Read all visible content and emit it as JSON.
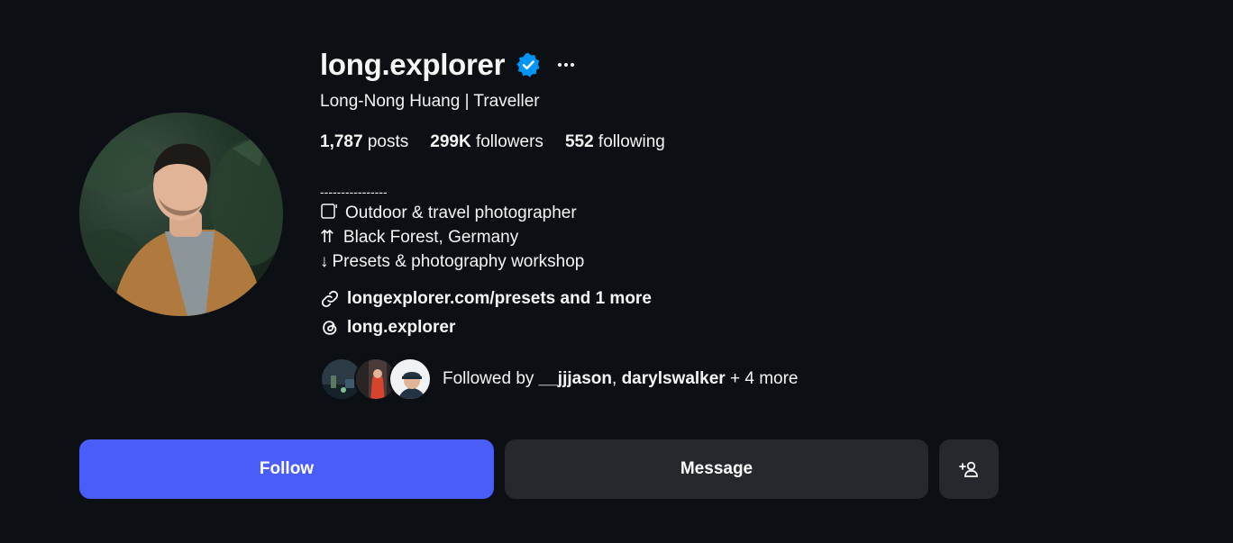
{
  "profile": {
    "username": "long.explorer",
    "full_name": "Long-Nong Huang | Traveller",
    "verified": true
  },
  "stats": {
    "posts_count": "1,787",
    "posts_label": "posts",
    "followers_count": "299K",
    "followers_label": "followers",
    "following_count": "552",
    "following_label": "following"
  },
  "bio": {
    "divider": "----------------",
    "line1": "Outdoor & travel photographer",
    "line1_icon": "camera-icon",
    "line2_prefix": "⇈",
    "line2": "Black Forest, Germany",
    "line3_prefix": "↓",
    "line3": "Presets & photography workshop"
  },
  "links": {
    "website": "longexplorer.com/presets and 1 more",
    "threads": "long.explorer"
  },
  "followed_by": {
    "prefix": "Followed by",
    "user1": "__jjjason",
    "separator": ",",
    "user2": "darylswalker",
    "suffix": "+ 4 more"
  },
  "buttons": {
    "follow": "Follow",
    "message": "Message"
  },
  "colors": {
    "background": "#0c1014",
    "follow_button": "#4a5df9",
    "secondary_button": "#25292e",
    "verified_badge": "#0095f6"
  },
  "icons": [
    "verified-badge-icon",
    "more-options-icon",
    "link-icon",
    "threads-icon",
    "add-user-icon"
  ]
}
